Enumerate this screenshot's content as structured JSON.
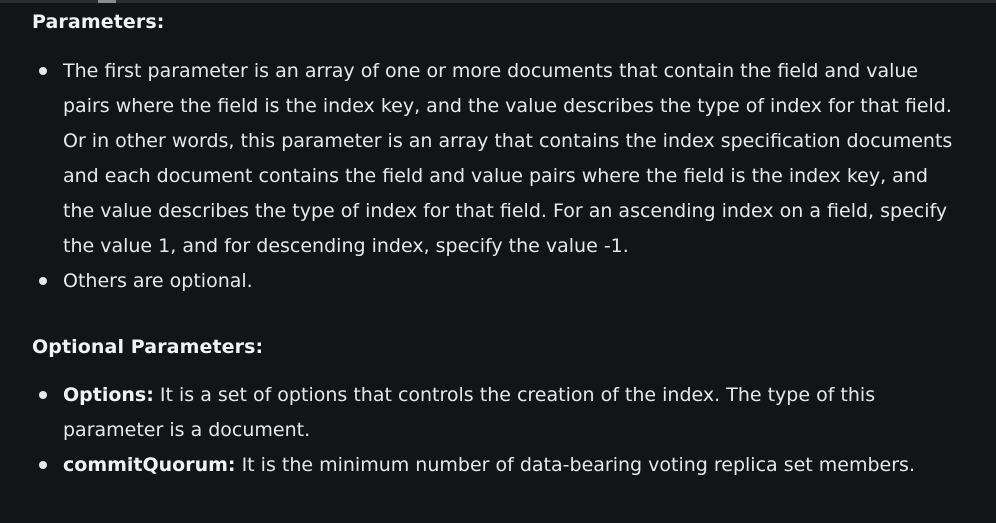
{
  "section_heading": "Parameters:",
  "parameters": [
    {
      "text": "The first parameter is an array of one or more documents that contain the field and value pairs where the field is the index key, and the value describes the type of index for that field. Or in other words, this parameter is an array that contains the index specification documents and each document contains the field and value pairs where the field is the index key, and the value describes the type of index for that field. For an ascending index on a field, specify the value 1, and for descending index, specify the value -1."
    },
    {
      "text": "Others are optional."
    }
  ],
  "optional_heading": "Optional Parameters:",
  "optional_parameters": [
    {
      "term": "Options:",
      "text": " It is a set of options that controls the creation of the index. The type of this parameter is a document."
    },
    {
      "term": "commitQuorum:",
      "text": " It is the minimum number of data-bearing voting replica set members."
    }
  ]
}
